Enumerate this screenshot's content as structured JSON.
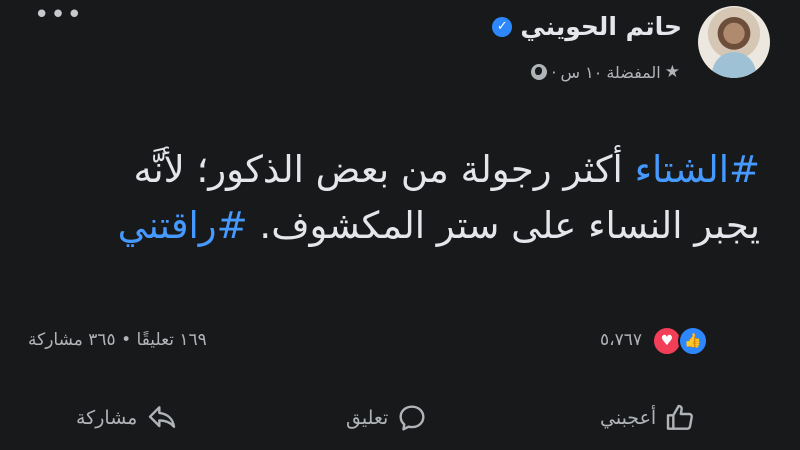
{
  "post": {
    "author": "حاتم الحويني",
    "meta": {
      "favorites": "المفضلة",
      "time": "١٠ س"
    },
    "text": {
      "hashtag1": "#الشتاء",
      "line1": " أكثر رجولة من بعض الذكور؛ لأنَّه",
      "line2": "يجبر النساء على ستر المكشوف. ",
      "hashtag2": "#راقتني"
    },
    "colors": {
      "background": "#18191a",
      "hashtag": "#4599ff",
      "like": "#2d88ff",
      "love": "#f33e58"
    }
  },
  "stats": {
    "reaction_count": "٥،٧٦٧",
    "comments": "١٦٩ تعليقًا",
    "separator": "•",
    "shares": "٣٦٥ مشاركة"
  },
  "actions": {
    "like": "أعجبني",
    "comment": "تعليق",
    "share": "مشاركة"
  },
  "icons": {
    "more": "more-options-icon",
    "verified": "verified-badge-icon",
    "star": "star-icon",
    "globe": "globe-icon",
    "like": "thumbs-up-icon",
    "comment": "comment-bubble-icon",
    "share": "share-arrow-icon"
  }
}
